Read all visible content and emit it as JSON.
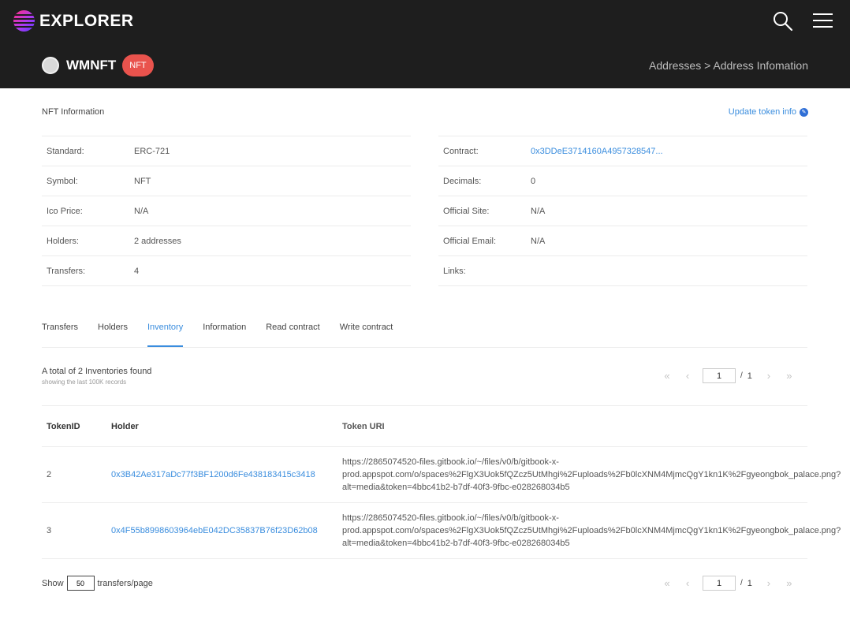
{
  "header": {
    "brand": "EXPLORER",
    "token_name": "WMNFT",
    "token_badge": "NFT",
    "breadcrumb": "Addresses > Address Infomation"
  },
  "section": {
    "title": "NFT Information",
    "update_link": "Update token info"
  },
  "info_left": [
    {
      "label": "Standard:",
      "value": "ERC-721"
    },
    {
      "label": "Symbol:",
      "value": "NFT"
    },
    {
      "label": "Ico Price:",
      "value": "N/A"
    },
    {
      "label": "Holders:",
      "value": "2 addresses"
    },
    {
      "label": "Transfers:",
      "value": "4"
    }
  ],
  "info_right": [
    {
      "label": "Contract:",
      "value": "0x3DDeE3714160A4957328547..."
    },
    {
      "label": "Decimals:",
      "value": "0"
    },
    {
      "label": "Official Site:",
      "value": "N/A"
    },
    {
      "label": "Official Email:",
      "value": "N/A"
    },
    {
      "label": "Links:",
      "value": ""
    }
  ],
  "tabs": [
    {
      "label": "Transfers",
      "active": false
    },
    {
      "label": "Holders",
      "active": false
    },
    {
      "label": "Inventory",
      "active": true
    },
    {
      "label": "Information",
      "active": false
    },
    {
      "label": "Read contract",
      "active": false
    },
    {
      "label": "Write contract",
      "active": false
    }
  ],
  "inventory": {
    "total_text": "A total of 2 Inventories found",
    "showing_text": "showing the last 100K records",
    "columns": [
      "TokenID",
      "Holder",
      "Token URI"
    ],
    "rows": [
      {
        "token_id": "2",
        "holder": "0x3B42Ae317aDc77f3BF1200d6Fe438183415c3418",
        "uri_lines": [
          "https://2865074520-files.gitbook.io/~/files/v0/b/gitbook-x-",
          "prod.appspot.com/o/spaces%2FlgX3Uok5fQZcz5UtMhgi%2Fuploads%2Fb0lcXNM4MjmcQgY1kn1K%2Fgyeongbok_palace.png?",
          "alt=media&token=4bbc41b2-b7df-40f3-9fbc-e028268034b5"
        ]
      },
      {
        "token_id": "3",
        "holder": "0x4F55b8998603964ebE042DC35837B76f23D62b08",
        "uri_lines": [
          "https://2865074520-files.gitbook.io/~/files/v0/b/gitbook-x-",
          "prod.appspot.com/o/spaces%2FlgX3Uok5fQZcz5UtMhgi%2Fuploads%2Fb0lcXNM4MjmcQgY1kn1K%2Fgyeongbok_palace.png?",
          "alt=media&token=4bbc41b2-b7df-40f3-9fbc-e028268034b5"
        ]
      }
    ]
  },
  "pagination": {
    "page": "1",
    "slash": "/",
    "total_pages": "1",
    "first": "«",
    "prev": "‹",
    "next": "›",
    "last": "»"
  },
  "footer": {
    "show_label": "Show",
    "page_size": "50",
    "per_page_label": "transfers/page"
  },
  "colors": {
    "header_bg": "#1e1e1e",
    "accent": "#3a8dde",
    "badge": "#e9534d"
  },
  "icons": {
    "search": "search-icon",
    "menu": "hamburger-menu-icon",
    "edit": "pencil-icon"
  }
}
